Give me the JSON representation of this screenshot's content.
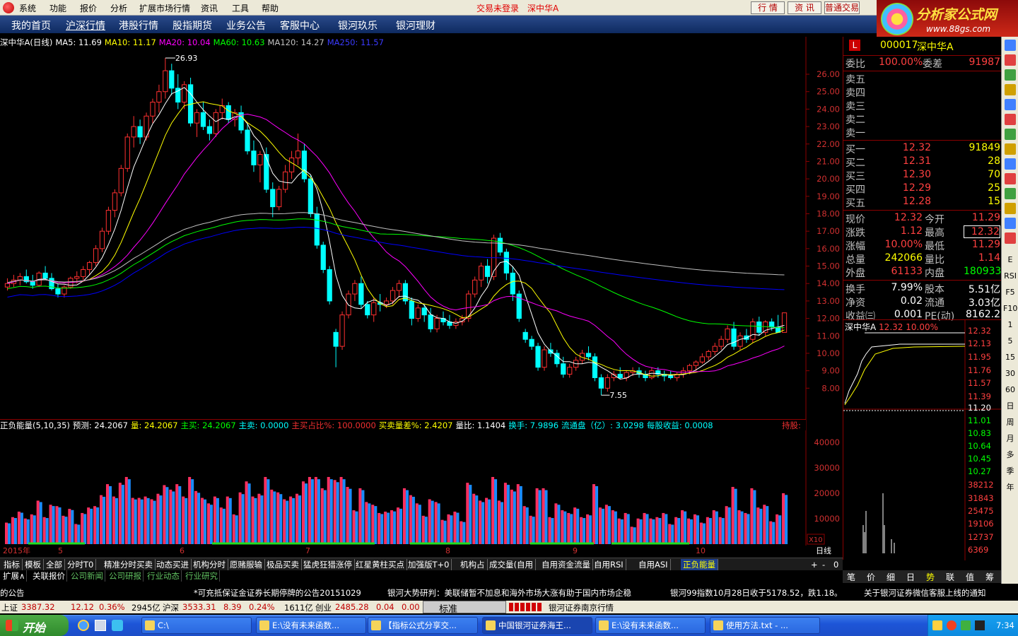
{
  "menu": {
    "items": [
      "系统",
      "功能",
      "报价",
      "分析",
      "扩展市场行情",
      "资讯",
      "工具",
      "帮助"
    ],
    "status": "交易未登录",
    "stock": "深中华A",
    "btn_quote": "行 情",
    "btn_info": "资 讯",
    "btn_trade": "普通交易"
  },
  "brand": {
    "title": "分析家公式网",
    "url": "www.88gs.com"
  },
  "nav": {
    "items": [
      "我的首页",
      "沪深行情",
      "港股行情",
      "股指期货",
      "业务公告",
      "客服中心",
      "银河玖乐",
      "银河理财"
    ],
    "active": 1
  },
  "ma_header": {
    "name": "深中华A(日线)",
    "ma5": "MA5: 11.69",
    "ma10": "MA10: 11.17",
    "ma20": "MA20: 10.04",
    "ma60": "MA60: 10.63",
    "ma120": "MA120: 14.27",
    "ma250": "MA250: 11.57",
    "colors": {
      "ma5": "#ffffff",
      "ma10": "#ffff00",
      "ma20": "#ff00ff",
      "ma60": "#00ff00",
      "ma120": "#c0c0c0",
      "ma250": "#0000ff"
    }
  },
  "chart_data": {
    "type": "candlestick",
    "y_ticks": [
      "26.00",
      "25.00",
      "24.00",
      "23.00",
      "22.00",
      "21.00",
      "20.00",
      "19.00",
      "18.00",
      "17.00",
      "16.00",
      "15.00",
      "14.00",
      "13.00",
      "12.00",
      "11.00",
      "10.00",
      "9.00",
      "8.00"
    ],
    "ylim": [
      7.0,
      27.5
    ],
    "high_label": "26.93",
    "low_label": "7.55",
    "x_labels": [
      "2015年",
      "5",
      "6",
      "7",
      "8",
      "9",
      "10"
    ],
    "ohlc": [
      [
        13.8,
        14.3,
        13.6,
        14.0
      ],
      [
        14.0,
        14.5,
        13.8,
        14.2
      ],
      [
        14.2,
        14.6,
        13.9,
        14.4
      ],
      [
        14.4,
        14.8,
        14.0,
        14.1
      ],
      [
        14.1,
        14.5,
        13.7,
        13.9
      ],
      [
        13.9,
        14.7,
        13.8,
        14.6
      ],
      [
        14.6,
        15.0,
        14.2,
        14.3
      ],
      [
        14.3,
        14.6,
        13.6,
        13.7
      ],
      [
        13.7,
        14.0,
        13.2,
        13.4
      ],
      [
        13.4,
        13.9,
        13.2,
        13.8
      ],
      [
        13.8,
        14.4,
        13.7,
        14.3
      ],
      [
        14.3,
        14.7,
        14.0,
        14.4
      ],
      [
        14.4,
        15.0,
        14.2,
        14.8
      ],
      [
        14.8,
        15.3,
        14.5,
        15.2
      ],
      [
        15.2,
        16.2,
        15.0,
        16.0
      ],
      [
        16.0,
        17.2,
        15.8,
        17.0
      ],
      [
        17.0,
        18.4,
        16.8,
        18.2
      ],
      [
        18.2,
        19.4,
        17.8,
        19.2
      ],
      [
        19.2,
        20.8,
        19.0,
        20.6
      ],
      [
        20.6,
        22.6,
        20.4,
        22.4
      ],
      [
        22.4,
        23.6,
        21.8,
        23.0
      ],
      [
        23.0,
        23.4,
        22.0,
        22.4
      ],
      [
        22.4,
        23.8,
        22.2,
        23.6
      ],
      [
        23.6,
        24.6,
        23.2,
        24.4
      ],
      [
        24.4,
        25.4,
        23.8,
        25.0
      ],
      [
        25.0,
        26.93,
        24.6,
        26.2
      ],
      [
        26.2,
        26.6,
        24.8,
        25.2
      ],
      [
        25.2,
        26.0,
        24.0,
        24.4
      ],
      [
        24.4,
        25.6,
        24.0,
        25.4
      ],
      [
        25.4,
        25.8,
        23.0,
        23.2
      ],
      [
        23.2,
        24.0,
        22.4,
        23.8
      ],
      [
        23.8,
        24.4,
        22.8,
        23.0
      ],
      [
        23.0,
        23.4,
        22.2,
        22.6
      ],
      [
        22.6,
        24.0,
        22.4,
        23.8
      ],
      [
        23.8,
        24.6,
        23.4,
        24.2
      ],
      [
        24.2,
        24.4,
        23.2,
        23.4
      ],
      [
        23.4,
        24.0,
        23.0,
        23.8
      ],
      [
        23.8,
        24.2,
        22.6,
        22.8
      ],
      [
        22.8,
        23.2,
        21.4,
        21.6
      ],
      [
        21.6,
        22.2,
        20.4,
        20.8
      ],
      [
        20.8,
        21.6,
        19.8,
        21.4
      ],
      [
        21.4,
        21.8,
        19.2,
        19.4
      ],
      [
        19.4,
        19.8,
        17.8,
        18.4
      ],
      [
        18.4,
        19.6,
        18.2,
        19.4
      ],
      [
        19.4,
        20.8,
        19.2,
        20.4
      ],
      [
        20.4,
        21.6,
        20.0,
        21.2
      ],
      [
        21.2,
        22.6,
        20.8,
        21.6
      ],
      [
        21.6,
        22.0,
        19.8,
        20.0
      ],
      [
        20.0,
        20.2,
        17.8,
        18.0
      ],
      [
        18.0,
        18.4,
        16.0,
        16.2
      ],
      [
        16.2,
        16.4,
        14.6,
        14.8
      ],
      [
        14.8,
        15.0,
        12.8,
        13.0
      ],
      [
        11.2,
        11.4,
        9.2,
        10.4
      ],
      [
        10.4,
        12.4,
        10.2,
        12.2
      ],
      [
        12.2,
        13.6,
        12.0,
        13.4
      ],
      [
        13.4,
        14.2,
        13.0,
        14.0
      ],
      [
        14.0,
        14.4,
        12.6,
        12.8
      ],
      [
        12.8,
        13.0,
        12.0,
        12.2
      ],
      [
        12.2,
        13.2,
        11.8,
        12.9
      ],
      [
        12.9,
        13.4,
        12.4,
        12.8
      ],
      [
        12.8,
        13.2,
        12.6,
        13.0
      ],
      [
        13.0,
        13.8,
        12.8,
        13.6
      ],
      [
        13.6,
        14.2,
        13.2,
        14.0
      ],
      [
        14.0,
        14.2,
        12.8,
        13.0
      ],
      [
        13.0,
        13.2,
        11.6,
        12.0
      ],
      [
        12.0,
        12.8,
        11.8,
        12.6
      ],
      [
        12.6,
        12.8,
        11.8,
        12.2
      ],
      [
        12.2,
        12.6,
        11.2,
        11.4
      ],
      [
        11.4,
        12.2,
        11.2,
        12.0
      ],
      [
        12.0,
        12.4,
        11.6,
        11.8
      ],
      [
        11.8,
        12.2,
        11.4,
        11.6
      ],
      [
        11.6,
        12.0,
        11.4,
        11.8
      ],
      [
        11.8,
        12.2,
        11.6,
        12.0
      ],
      [
        12.0,
        13.6,
        11.8,
        13.4
      ],
      [
        13.4,
        14.4,
        13.2,
        14.2
      ],
      [
        14.2,
        15.2,
        13.8,
        15.0
      ],
      [
        15.0,
        15.4,
        14.0,
        14.4
      ],
      [
        14.4,
        16.8,
        14.2,
        16.6
      ],
      [
        16.6,
        16.9,
        15.6,
        15.8
      ],
      [
        15.8,
        16.0,
        14.2,
        14.6
      ],
      [
        14.6,
        15.0,
        13.0,
        13.4
      ],
      [
        13.4,
        13.6,
        11.8,
        12.0
      ],
      [
        11.2,
        11.4,
        10.6,
        10.8
      ],
      [
        10.8,
        11.0,
        10.2,
        10.4
      ],
      [
        10.4,
        10.6,
        9.0,
        9.2
      ],
      [
        9.2,
        10.4,
        9.0,
        10.2
      ],
      [
        10.2,
        10.6,
        9.8,
        10.0
      ],
      [
        10.0,
        10.2,
        9.2,
        9.4
      ],
      [
        9.4,
        9.8,
        8.6,
        8.8
      ],
      [
        8.8,
        9.4,
        8.6,
        9.2
      ],
      [
        9.2,
        9.8,
        9.0,
        9.6
      ],
      [
        9.6,
        10.2,
        9.4,
        10.0
      ],
      [
        10.0,
        10.4,
        9.6,
        9.8
      ],
      [
        9.8,
        10.0,
        8.4,
        8.6
      ],
      [
        8.6,
        8.8,
        7.6,
        8.0
      ],
      [
        8.0,
        8.8,
        7.8,
        8.6
      ],
      [
        8.6,
        9.0,
        8.4,
        8.8
      ],
      [
        8.8,
        9.2,
        8.5,
        8.6
      ],
      [
        8.6,
        9.0,
        8.4,
        8.9
      ],
      [
        8.9,
        9.2,
        8.7,
        9.0
      ],
      [
        9.0,
        9.2,
        8.6,
        8.8
      ],
      [
        8.8,
        9.0,
        8.4,
        8.6
      ],
      [
        8.6,
        9.2,
        8.5,
        9.0
      ],
      [
        9.0,
        9.2,
        8.6,
        8.8
      ],
      [
        8.8,
        9.0,
        8.4,
        8.7
      ],
      [
        8.7,
        9.0,
        8.5,
        8.6
      ],
      [
        8.6,
        8.9,
        8.4,
        8.8
      ],
      [
        8.8,
        9.2,
        8.6,
        9.0
      ],
      [
        9.0,
        9.4,
        8.8,
        9.3
      ],
      [
        9.3,
        9.6,
        9.0,
        9.5
      ],
      [
        9.5,
        10.0,
        9.4,
        9.8
      ],
      [
        9.8,
        10.2,
        9.6,
        10.1
      ],
      [
        10.1,
        10.6,
        9.9,
        10.4
      ],
      [
        10.4,
        11.0,
        10.2,
        10.8
      ],
      [
        10.8,
        11.6,
        10.6,
        11.4
      ],
      [
        11.4,
        11.8,
        10.2,
        10.4
      ],
      [
        10.4,
        11.2,
        10.2,
        11.0
      ],
      [
        11.0,
        11.4,
        10.6,
        10.8
      ],
      [
        10.8,
        12.0,
        10.6,
        11.8
      ],
      [
        11.8,
        12.1,
        11.0,
        11.2
      ],
      [
        11.2,
        11.9,
        11.0,
        11.8
      ],
      [
        11.8,
        12.0,
        11.3,
        11.5
      ],
      [
        11.5,
        12.2,
        11.4,
        11.2
      ],
      [
        11.2,
        12.32,
        11.2,
        12.32
      ]
    ],
    "ma_colors": [
      "#ffffff",
      "#ffff00",
      "#ff00ff",
      "#00ff00",
      "#c0c0c0",
      "#0000ff"
    ],
    "volume_ticks": [
      "40000",
      "30000",
      "20000",
      "10000"
    ],
    "volume_unit": "X10"
  },
  "vol_header": {
    "name": "正负能量(5,10,35)",
    "pred": "预测: 24.2067",
    "vol": "量: 24.2067",
    "buy": "主买: 24.2067",
    "sell": "主卖: 0.0000",
    "ratio": "主买占比%: 100.0000",
    "diff": "买卖量差%: 2.4207",
    "volratio": "量比: 1.1404",
    "turnover": "换手: 7.9896",
    "float": "流通盘（亿）: 3.0298",
    "eps": "每股收益: 0.0008",
    "hold": "持股: "
  },
  "tabs": [
    "指标",
    "模板",
    "全部",
    "分时T0",
    "精准分时买卖",
    "动态买进",
    "机构分时",
    "愿赌服输",
    "极品买卖",
    "猛虎狂猎涨停",
    "红星黄柱买点",
    "加强版T+0",
    "机构占",
    "成交量(自用",
    "自用资金流量",
    "自用RSI",
    "自用ASI",
    "正负能量"
  ],
  "tabs_selected": "正负能量",
  "tabs_right": [
    "+",
    "-",
    "0"
  ],
  "period": "日线",
  "tabs2": [
    "扩展∧",
    "关联报价",
    "公司新闻",
    "公司研报",
    "行业动态",
    "行业研究"
  ],
  "news": [
    "的公告",
    "*可充抵保证金证券长期停牌的公告20151029",
    "银河大势研判：美联储暂不加息和海外市场大涨有助于国内市场企稳",
    "银河99指数10月28日收于5178.52，跌1.18。",
    "关于银河证券微信客服上线的通知"
  ],
  "indexbar": {
    "sh_name": "上证",
    "sh": "3387.32",
    "sh_chg": "12.12",
    "sh_pct": "0.36%",
    "sh_amt": "2945亿",
    "sz_name": "沪深",
    "sz": "3533.31",
    "sz_chg": "8.39",
    "sz_pct": "0.24%",
    "sz_amt": "1611亿",
    "cy_name": "创业",
    "cy": "2485.28",
    "cy_chg": "0.04",
    "cy_pct": "0.00",
    "mode": "标准",
    "broker": "银河证券南京行情"
  },
  "taskbar": {
    "start": "开始",
    "tasks": [
      "C:\\",
      "E:\\没有未来函数...",
      "【指标公式分享交...",
      "中国银河证券海王...",
      "E:\\没有未来函数...",
      "使用方法.txt - ..."
    ],
    "active": 3,
    "time": "7:34"
  },
  "quote": {
    "code": "000017",
    "name": "深中华A",
    "weibi_lbl": "委比",
    "weibi": "100.00%",
    "weicha_lbl": "委差",
    "weicha": "91987",
    "sells": [
      {
        "l": "卖五",
        "p": "",
        "v": ""
      },
      {
        "l": "卖四",
        "p": "",
        "v": ""
      },
      {
        "l": "卖三",
        "p": "",
        "v": ""
      },
      {
        "l": "卖二",
        "p": "",
        "v": ""
      },
      {
        "l": "卖一",
        "p": "",
        "v": ""
      }
    ],
    "buys": [
      {
        "l": "买一",
        "p": "12.32",
        "v": "91849"
      },
      {
        "l": "买二",
        "p": "12.31",
        "v": "28"
      },
      {
        "l": "买三",
        "p": "12.30",
        "v": "70"
      },
      {
        "l": "买四",
        "p": "12.29",
        "v": "25"
      },
      {
        "l": "买五",
        "p": "12.28",
        "v": "15"
      }
    ],
    "stats": [
      {
        "l1": "现价",
        "v1": "12.32",
        "l2": "今开",
        "v2": "11.29"
      },
      {
        "l1": "涨跌",
        "v1": "1.12",
        "l2": "最高",
        "v2": "12.32"
      },
      {
        "l1": "涨幅",
        "v1": "10.00%",
        "l2": "最低",
        "v2": "11.29"
      },
      {
        "l1": "总量",
        "v1": "242066",
        "l2": "量比",
        "v2": "1.14"
      },
      {
        "l1": "外盘",
        "v1": "61133",
        "l2": "内盘",
        "v2": "180933"
      },
      {
        "l1": "换手",
        "v1": "7.99%",
        "l2": "股本",
        "v2": "5.51亿"
      },
      {
        "l1": "净资",
        "v1": "0.02",
        "l2": "流通",
        "v2": "3.03亿"
      },
      {
        "l1": "收益㈢",
        "v1": "0.001",
        "l2": "PE(动)",
        "v2": "8162.2"
      }
    ]
  },
  "mini": {
    "name": "深中华A",
    "price": "12.32",
    "pct": "10.00%",
    "ticks": [
      "12.32",
      "12.13",
      "11.95",
      "11.76",
      "11.57",
      "11.39",
      "11.20",
      "11.01",
      "10.83",
      "10.64",
      "10.45",
      "10.27",
      "38212",
      "31843",
      "25475",
      "19106",
      "12737",
      "6369"
    ]
  },
  "minibtns": [
    "笔",
    "价",
    "细",
    "日",
    "势",
    "联",
    "值",
    "筹"
  ],
  "rtool": [
    "E",
    "RSI",
    "F5",
    "F10",
    "1",
    "5",
    "15",
    "30",
    "60",
    "日",
    "周",
    "月",
    "多",
    "季",
    "年"
  ]
}
